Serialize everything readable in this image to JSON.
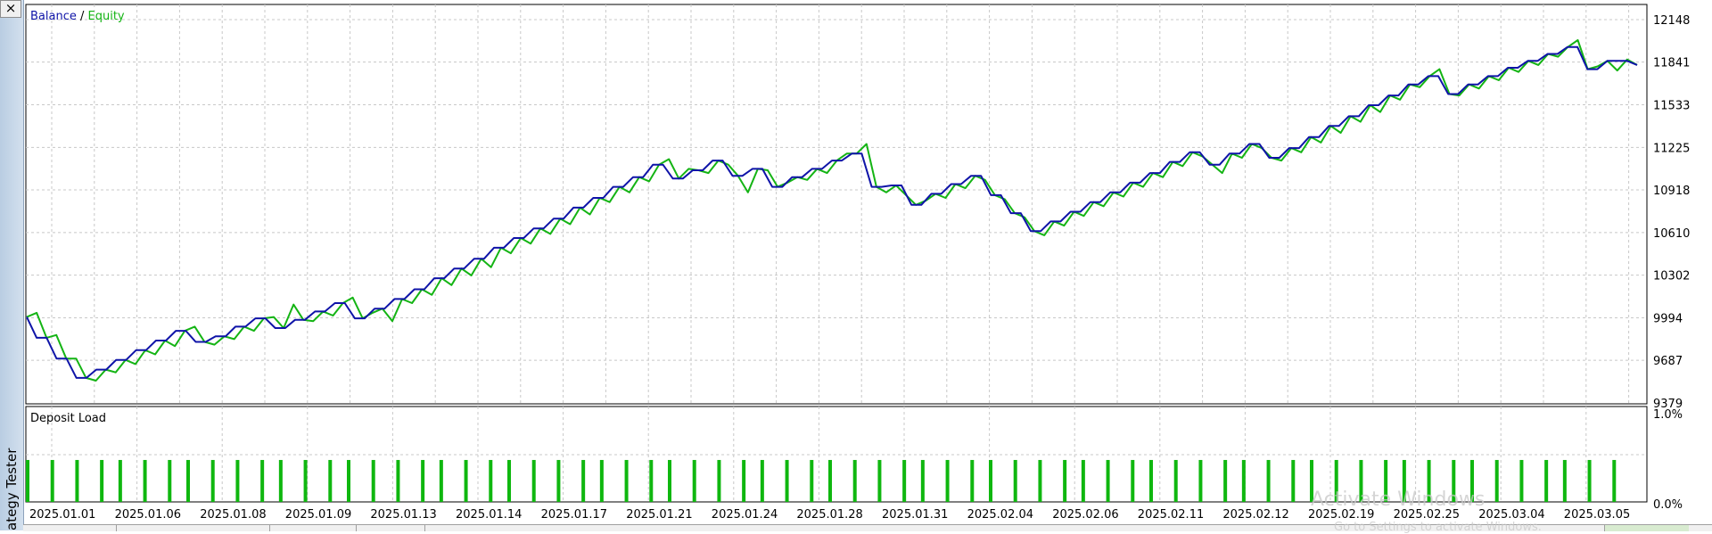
{
  "window": {
    "close_label": "×",
    "side_title": "ategy Tester"
  },
  "chart": {
    "legend_balance": "Balance",
    "legend_sep": " / ",
    "legend_equity": "Equity",
    "subchart_title": "Deposit Load"
  },
  "watermark": {
    "line1": "Activate Windows",
    "line2": "Go to Settings to activate Windows."
  },
  "colors": {
    "balance": "#0f14a8",
    "equity": "#14b414",
    "load_bar": "#0fb70f",
    "grid": "#c8c8c8"
  },
  "chart_data": [
    {
      "type": "line",
      "yticks": [
        12148,
        11841,
        11533,
        11225,
        10918,
        10610,
        10302,
        9994,
        9687,
        9379
      ],
      "ylim": [
        9379,
        12148
      ],
      "x_dates": [
        "2025.01.01",
        "2025.01.06",
        "2025.01.08",
        "2025.01.09",
        "2025.01.13",
        "2025.01.14",
        "2025.01.17",
        "2025.01.21",
        "2025.01.24",
        "2025.01.28",
        "2025.01.31",
        "2025.02.04",
        "2025.02.06",
        "2025.02.11",
        "2025.02.12",
        "2025.02.19",
        "2025.02.25",
        "2025.03.04",
        "2025.03.05"
      ],
      "series": [
        {
          "name": "Balance",
          "values": [
            10000,
            9850,
            9850,
            9700,
            9700,
            9560,
            9560,
            9620,
            9620,
            9690,
            9690,
            9760,
            9760,
            9830,
            9830,
            9900,
            9900,
            9820,
            9820,
            9860,
            9860,
            9930,
            9930,
            9990,
            9990,
            9920,
            9920,
            9980,
            9980,
            10040,
            10040,
            10100,
            10100,
            9990,
            9990,
            10060,
            10060,
            10130,
            10130,
            10200,
            10200,
            10280,
            10280,
            10350,
            10350,
            10420,
            10420,
            10500,
            10500,
            10570,
            10570,
            10640,
            10640,
            10710,
            10710,
            10790,
            10790,
            10860,
            10860,
            10940,
            10940,
            11010,
            11010,
            11100,
            11100,
            11000,
            11000,
            11060,
            11060,
            11130,
            11130,
            11020,
            11020,
            11070,
            11070,
            10940,
            10940,
            11010,
            11010,
            11070,
            11070,
            11130,
            11130,
            11180,
            11180,
            10940,
            10940,
            10950,
            10950,
            10810,
            10810,
            10890,
            10890,
            10960,
            10960,
            11020,
            11020,
            10880,
            10880,
            10750,
            10750,
            10620,
            10620,
            10690,
            10690,
            10760,
            10760,
            10830,
            10830,
            10900,
            10900,
            10970,
            10970,
            11040,
            11040,
            11120,
            11120,
            11190,
            11190,
            11100,
            11100,
            11180,
            11180,
            11250,
            11250,
            11150,
            11150,
            11220,
            11220,
            11300,
            11300,
            11380,
            11380,
            11450,
            11450,
            11530,
            11530,
            11600,
            11600,
            11680,
            11680,
            11740,
            11740,
            11610,
            11610,
            11680,
            11680,
            11740,
            11740,
            11800,
            11800,
            11850,
            11850,
            11900,
            11900,
            11950,
            11950,
            11790,
            11790,
            11850,
            11850,
            11850,
            11820
          ]
        },
        {
          "name": "Equity",
          "values": [
            10000,
            10030,
            9850,
            9870,
            9700,
            9700,
            9560,
            9540,
            9620,
            9600,
            9690,
            9660,
            9760,
            9730,
            9830,
            9790,
            9900,
            9930,
            9820,
            9800,
            9860,
            9840,
            9930,
            9900,
            9990,
            10000,
            9920,
            10090,
            9980,
            9970,
            10040,
            10010,
            10100,
            10140,
            9990,
            10030,
            10060,
            9970,
            10130,
            10100,
            10200,
            10160,
            10280,
            10230,
            10350,
            10300,
            10420,
            10360,
            10500,
            10460,
            10570,
            10530,
            10640,
            10600,
            10710,
            10670,
            10790,
            10740,
            10860,
            10830,
            10940,
            10900,
            11010,
            10980,
            11100,
            11140,
            11000,
            11070,
            11060,
            11040,
            11130,
            11100,
            11020,
            10900,
            11070,
            11060,
            10940,
            10970,
            11010,
            10990,
            11070,
            11040,
            11130,
            11180,
            11180,
            11250,
            10940,
            10900,
            10950,
            10880,
            10810,
            10840,
            10890,
            10860,
            10960,
            10930,
            11020,
            10990,
            10880,
            10850,
            10750,
            10720,
            10620,
            10590,
            10690,
            10660,
            10760,
            10730,
            10830,
            10800,
            10900,
            10870,
            10970,
            10940,
            11040,
            11010,
            11120,
            11090,
            11190,
            11160,
            11100,
            11040,
            11180,
            11150,
            11250,
            11220,
            11150,
            11130,
            11220,
            11190,
            11300,
            11260,
            11380,
            11330,
            11450,
            11410,
            11530,
            11480,
            11600,
            11570,
            11680,
            11660,
            11740,
            11790,
            11610,
            11600,
            11680,
            11650,
            11740,
            11710,
            11800,
            11770,
            11850,
            11820,
            11900,
            11880,
            11950,
            12000,
            11790,
            11810,
            11850,
            11780,
            11860,
            11820
          ]
        }
      ]
    },
    {
      "type": "bar",
      "title": "Deposit Load",
      "yticks": [
        "1.0%",
        "0.0%"
      ],
      "ylim": [
        0,
        1.0
      ],
      "bar_value": 0.48,
      "bar_count": 70
    }
  ]
}
